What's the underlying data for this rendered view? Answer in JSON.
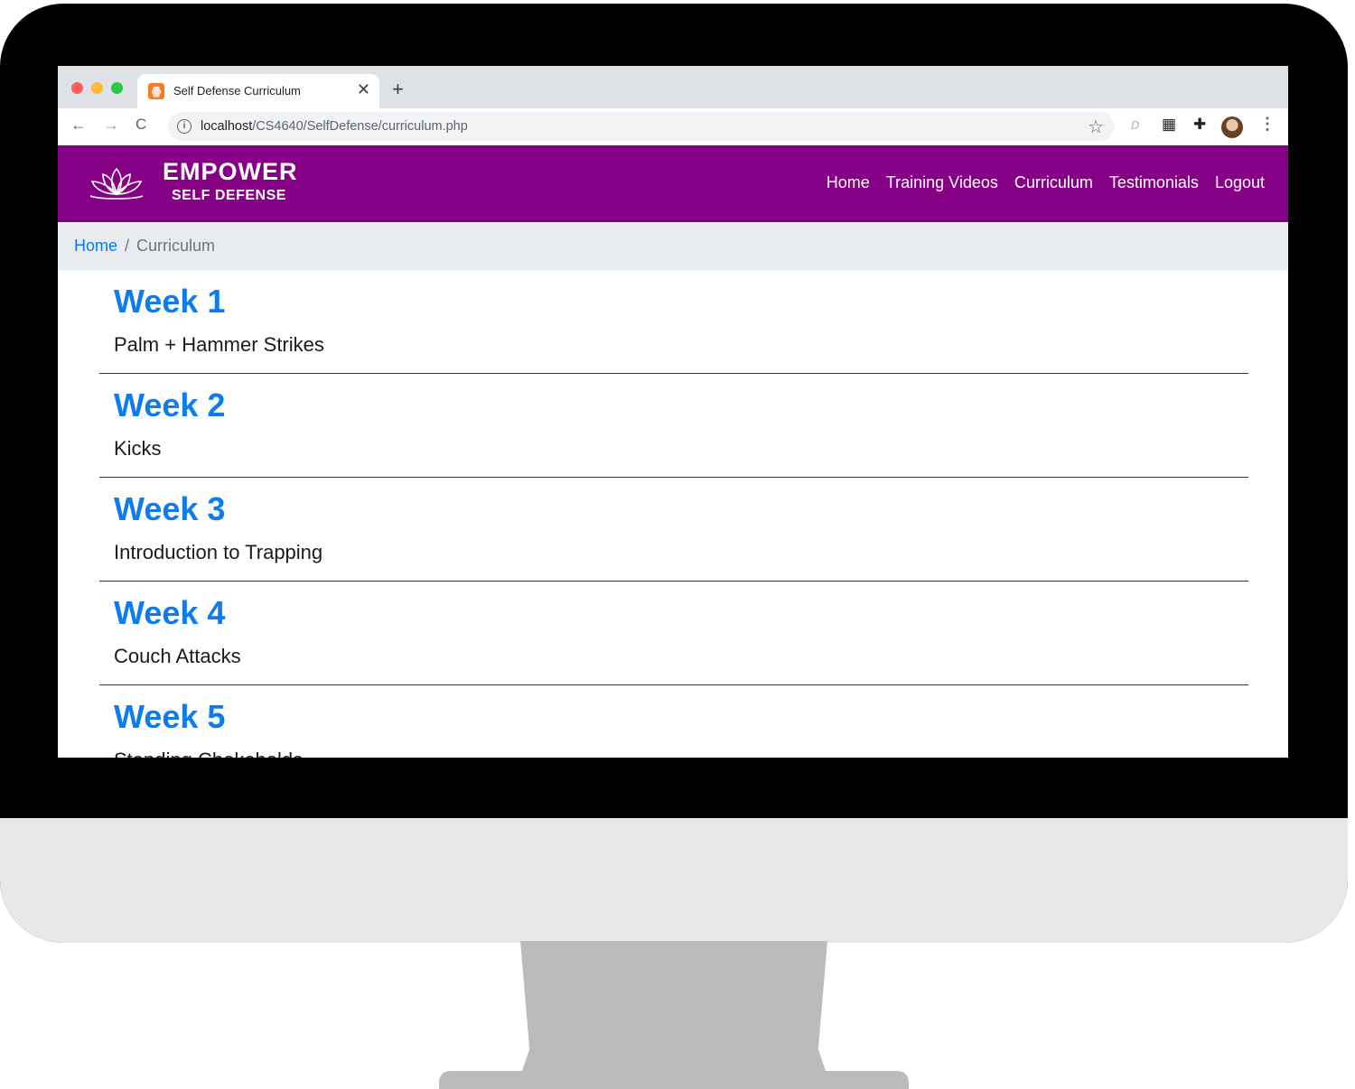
{
  "browser": {
    "tab_title": "Self Defense Curriculum",
    "tab_close": "✕",
    "new_tab": "+",
    "url_host": "localhost",
    "url_path": "/CS4640/SelfDefense/curriculum.php"
  },
  "site": {
    "brand_main": "EMPOWER",
    "brand_sub": "SELF DEFENSE",
    "brand_color": "#850085",
    "nav": [
      "Home",
      "Training Videos",
      "Curriculum",
      "Testimonials",
      "Logout"
    ]
  },
  "breadcrumb": {
    "home": "Home",
    "separator": "/",
    "current": "Curriculum"
  },
  "weeks": [
    {
      "title": "Week 1",
      "topic": "Palm + Hammer Strikes"
    },
    {
      "title": "Week 2",
      "topic": "Kicks"
    },
    {
      "title": "Week 3",
      "topic": "Introduction to Trapping"
    },
    {
      "title": "Week 4",
      "topic": "Couch Attacks"
    },
    {
      "title": "Week 5",
      "topic": "Standing Chokeholds"
    }
  ],
  "icons": {
    "back": "arrow-left-icon",
    "forward": "arrow-right-icon",
    "reload": "reload-icon",
    "info": "info-icon",
    "star": "star-icon",
    "extensions": "puzzle-icon",
    "lotus": "lotus-logo-icon"
  }
}
